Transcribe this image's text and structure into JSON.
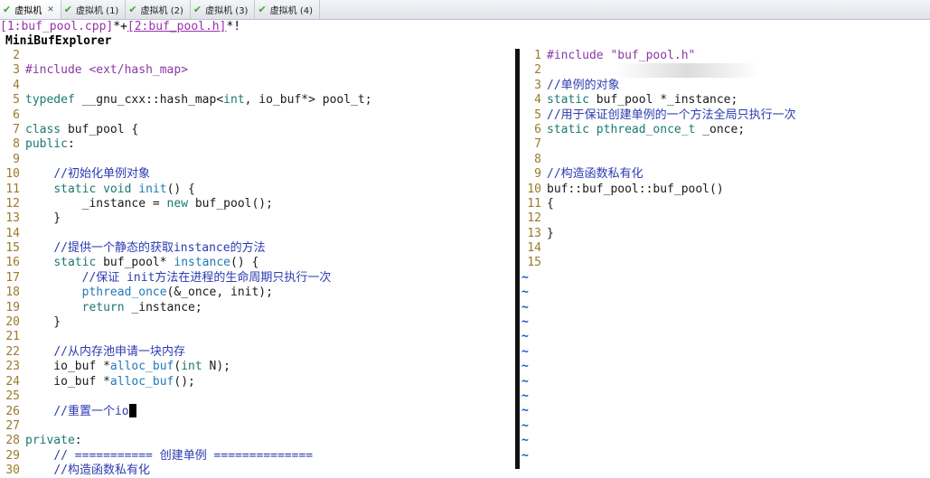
{
  "tabs": [
    {
      "label": "虚拟机",
      "active": true
    },
    {
      "label": "虚拟机 (1)",
      "active": false
    },
    {
      "label": "虚拟机 (2)",
      "active": false
    },
    {
      "label": "虚拟机 (3)",
      "active": false
    },
    {
      "label": "虚拟机 (4)",
      "active": false
    }
  ],
  "buffers": {
    "buf1": "[1:buf_pool.cpp]",
    "sep1": "*+",
    "buf2": "[2:buf_pool.h]",
    "sep2": "*!"
  },
  "explorer_title": "MiniBufExplorer",
  "left_lines": [
    {
      "n": "2",
      "t": ""
    },
    {
      "n": "3",
      "t": "#include <ext/hash_map>"
    },
    {
      "n": "4",
      "t": ""
    },
    {
      "n": "5",
      "t": "typedef __gnu_cxx::hash_map<int, io_buf*> pool_t;"
    },
    {
      "n": "6",
      "t": ""
    },
    {
      "n": "7",
      "t": "class buf_pool {"
    },
    {
      "n": "8",
      "t": "public:"
    },
    {
      "n": "9",
      "t": ""
    },
    {
      "n": "10",
      "t": "    //初始化单例对象"
    },
    {
      "n": "11",
      "t": "    static void init() {"
    },
    {
      "n": "12",
      "t": "        _instance = new buf_pool();"
    },
    {
      "n": "13",
      "t": "    }"
    },
    {
      "n": "14",
      "t": ""
    },
    {
      "n": "15",
      "t": "    //提供一个静态的获取instance的方法"
    },
    {
      "n": "16",
      "t": "    static buf_pool* instance() {"
    },
    {
      "n": "17",
      "t": "        //保证 init方法在进程的生命周期只执行一次"
    },
    {
      "n": "18",
      "t": "        pthread_once(&_once, init);"
    },
    {
      "n": "19",
      "t": "        return _instance;"
    },
    {
      "n": "20",
      "t": "    }"
    },
    {
      "n": "21",
      "t": ""
    },
    {
      "n": "22",
      "t": "    //从内存池申请一块内存"
    },
    {
      "n": "23",
      "t": "    io_buf *alloc_buf(int N);"
    },
    {
      "n": "24",
      "t": "    io_buf *alloc_buf();"
    },
    {
      "n": "25",
      "t": ""
    },
    {
      "n": "26",
      "t": "    //重置一个io"
    },
    {
      "n": "27",
      "t": ""
    },
    {
      "n": "28",
      "t": "private:"
    },
    {
      "n": "29",
      "t": "    // =========== 创建单例 =============="
    },
    {
      "n": "30",
      "t": "    //构造函数私有化"
    }
  ],
  "right_lines": [
    {
      "n": "1",
      "t": "#include \"buf_pool.h\""
    },
    {
      "n": "2",
      "t": ""
    },
    {
      "n": "3",
      "t": "//单例的对象"
    },
    {
      "n": "4",
      "t": "static buf_pool *_instance;"
    },
    {
      "n": "5",
      "t": "//用于保证创建单例的一个方法全局只执行一次"
    },
    {
      "n": "6",
      "t": "static pthread_once_t _once;"
    },
    {
      "n": "7",
      "t": ""
    },
    {
      "n": "8",
      "t": ""
    },
    {
      "n": "9",
      "t": "//构造函数私有化"
    },
    {
      "n": "10",
      "t": "buf::buf_pool::buf_pool()"
    },
    {
      "n": "11",
      "t": "{"
    },
    {
      "n": "12",
      "t": ""
    },
    {
      "n": "13",
      "t": "}"
    },
    {
      "n": "14",
      "t": ""
    },
    {
      "n": "15",
      "t": ""
    }
  ],
  "tilde": "~",
  "tilde_count": 13,
  "colors": {
    "line_number": "#9a7a2a",
    "comment": "#2b3bb0",
    "keyword": "#1a7a70",
    "tilde": "#1a55c8"
  }
}
